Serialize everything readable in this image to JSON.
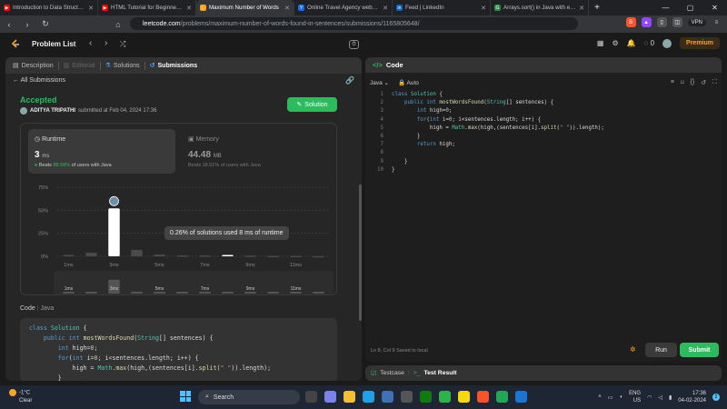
{
  "browser": {
    "tabs": [
      {
        "title": "Introduction to Data Structures a",
        "color": "#ff0000",
        "glyph": "▶"
      },
      {
        "title": "HTML Tutorial for Beginners | Co",
        "color": "#ff0000",
        "glyph": "▶"
      },
      {
        "title": "Maximum Number of Words",
        "color": "#ffa116",
        "glyph": "L",
        "active": true
      },
      {
        "title": "Online Travel Agency website | Fi",
        "color": "#1769ff",
        "glyph": "Y"
      },
      {
        "title": "Feed | LinkedIn",
        "color": "#0a66c2",
        "glyph": "in"
      },
      {
        "title": "Arrays.sort() in Java with examp",
        "color": "#2f8d46",
        "glyph": "G"
      }
    ],
    "url_domain": "leetcode.com",
    "url_path": "/problems/maximum-number-of-words-found-in-sentences/submissions/1165805648/",
    "vpn": "VPN"
  },
  "leetcode": {
    "problem_list": "Problem List",
    "coins": "0",
    "premium": "Premium"
  },
  "left": {
    "tabs": {
      "description": "Description",
      "editorial": "Editorial",
      "solutions": "Solutions",
      "submissions": "Submissions"
    },
    "all_submissions": "All Submissions",
    "status": "Accepted",
    "user": "ADITYA TRIPATHI",
    "submitted": "submitted at Feb 04, 2024 17:36",
    "solution_btn": "Solution",
    "runtime": {
      "label": "Runtime",
      "value": "3",
      "unit": "ms",
      "beats_prefix": "Beats",
      "beats_pct": "88.58%",
      "beats_suffix": "of users with Java"
    },
    "memory": {
      "label": "Memory",
      "value": "44.48",
      "unit": "MB",
      "beats": "Beats 18.51% of users with Java"
    },
    "tooltip": "0.26% of solutions used 8 ms of runtime",
    "code_label": "Code",
    "code_lang": "Java"
  },
  "chart_data": {
    "type": "bar",
    "ylabels": [
      "75%",
      "50%",
      "25%",
      "0%"
    ],
    "ylim": [
      0,
      75
    ],
    "xlabels": [
      "1ms",
      "3ms",
      "5ms",
      "7ms",
      "9ms",
      "11ms"
    ],
    "values": [
      1.5,
      4,
      52,
      7,
      2,
      1,
      1,
      1.5,
      0.8,
      0.5,
      0.5,
      0.3
    ],
    "highlight_index": 2,
    "selected_index": 7,
    "overview_labels": [
      "1ms",
      "3ms",
      "5ms",
      "7ms",
      "9ms",
      "11ms"
    ]
  },
  "right": {
    "code_title": "Code",
    "lang": "Java",
    "auto": "Auto",
    "line_numbers": "1\n2\n3\n4\n5\n6\n7\n8\n9\n10",
    "status": "Ln 8, Col 9    Saved to local",
    "run": "Run",
    "submit": "Submit",
    "testcase": "Testcase",
    "test_result": "Test Result"
  },
  "taskbar": {
    "temp": "-1°C",
    "weather": "Clear",
    "search": "Search",
    "lang1": "ENG",
    "lang2": "US",
    "time": "17:36",
    "date": "04-02-2024"
  }
}
